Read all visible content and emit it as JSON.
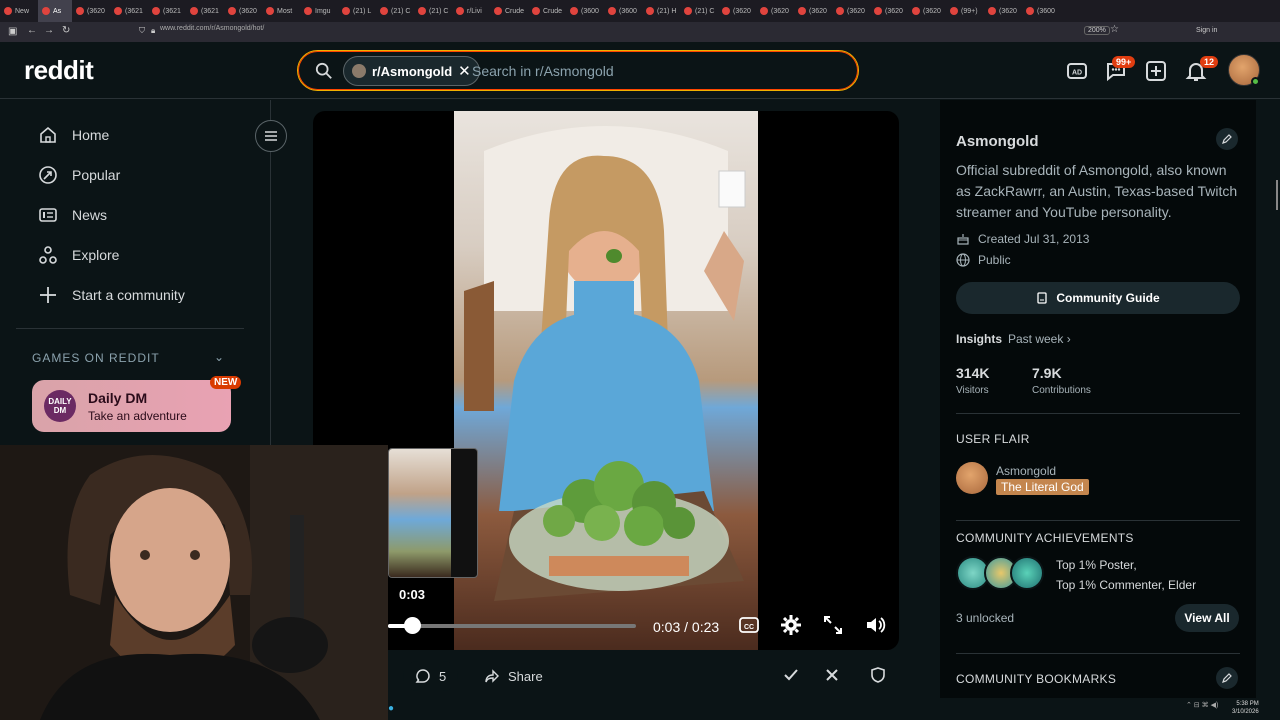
{
  "browser": {
    "tabs": [
      "New",
      "As",
      "(3620",
      "(3621",
      "(3621",
      "(3621",
      "(3620",
      "Most",
      "Imgu",
      "(21) L",
      "(21) C",
      "(21) C",
      "r/Livi",
      "Crude",
      "Crude",
      "(3600",
      "(3600",
      "(21) H",
      "(21) C",
      "(3620",
      "(3620",
      "(3620",
      "(3620",
      "(3620",
      "(3620",
      "(99+)",
      "(3620",
      "(3600"
    ],
    "url": "www.reddit.com/r/Asmongold/hot/",
    "zoom": "200%",
    "signin": "Sign in"
  },
  "header": {
    "logo": "reddit",
    "search_chip": "r/Asmongold",
    "search_placeholder": "Search in r/Asmongold",
    "chat_badge": "99+",
    "notif_badge": "12"
  },
  "sidebar": {
    "items": [
      {
        "label": "Home",
        "icon": "home-icon"
      },
      {
        "label": "Popular",
        "icon": "popular-icon"
      },
      {
        "label": "News",
        "icon": "news-icon"
      },
      {
        "label": "Explore",
        "icon": "explore-icon"
      },
      {
        "label": "Start a community",
        "icon": "plus-icon"
      }
    ],
    "games_header": "GAMES ON REDDIT",
    "daily_dm": {
      "logo": "DAILY DM",
      "title": "Daily DM",
      "subtitle": "Take an adventure",
      "badge": "NEW"
    }
  },
  "video": {
    "thumb_time": "0:03",
    "time": "0:03 / 0:23",
    "progress": 0.13
  },
  "actions": {
    "comments": "5",
    "share": "Share"
  },
  "rightbar": {
    "name": "Asmongold",
    "description": "Official subreddit of Asmongold, also known as ZackRawrr, an Austin, Texas-based Twitch streamer and YouTube personality.",
    "created": "Created Jul 31, 2013",
    "visibility": "Public",
    "guide": "Community Guide",
    "insights": "Insights",
    "insights_period": "Past week",
    "stats": [
      {
        "value": "314K",
        "label": "Visitors"
      },
      {
        "value": "7.9K",
        "label": "Contributions"
      }
    ],
    "user_flair_title": "USER FLAIR",
    "flair_name": "Asmongold",
    "flair_tag": "The Literal God",
    "achievements_title": "COMMUNITY ACHIEVEMENTS",
    "achievements_line1": "Top 1% Poster,",
    "achievements_line2": "Top 1% Commenter, Elder",
    "unlocked": "3 unlocked",
    "view_all": "View All",
    "bookmarks_title": "COMMUNITY BOOKMARKS"
  },
  "taskbar": {
    "time": "5:38 PM",
    "date": "3/10/2026"
  },
  "colors": {
    "bg": "#0b1416",
    "accent": "#ff4500",
    "flair": "#c4864e"
  }
}
